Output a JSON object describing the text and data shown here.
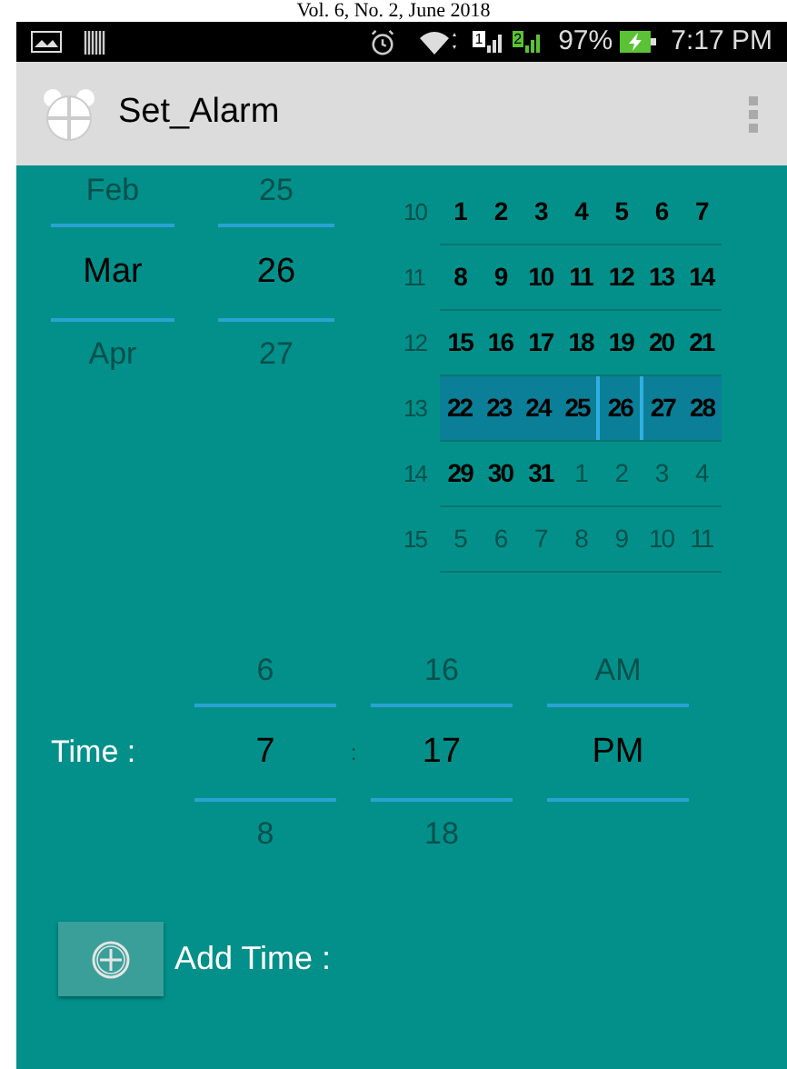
{
  "page_header": "Vol. 6, No. 2, June 2018",
  "status_bar": {
    "sim_1": "1",
    "sim_2": "2",
    "battery": "97%",
    "time": "7:17 PM"
  },
  "app_bar": {
    "title": "Set_Alarm"
  },
  "date_picker": {
    "months": [
      {
        "label": "Feb",
        "selected": false
      },
      {
        "label": "Mar",
        "selected": true
      },
      {
        "label": "Apr",
        "selected": false
      }
    ],
    "days": [
      {
        "label": "25",
        "selected": false
      },
      {
        "label": "26",
        "selected": true
      },
      {
        "label": "27",
        "selected": false
      }
    ]
  },
  "calendar": {
    "weeks": [
      {
        "number": "10",
        "selected": false,
        "days": [
          {
            "label": "1",
            "in_month": true,
            "selected": false
          },
          {
            "label": "2",
            "in_month": true,
            "selected": false
          },
          {
            "label": "3",
            "in_month": true,
            "selected": false
          },
          {
            "label": "4",
            "in_month": true,
            "selected": false
          },
          {
            "label": "5",
            "in_month": true,
            "selected": false
          },
          {
            "label": "6",
            "in_month": true,
            "selected": false
          },
          {
            "label": "7",
            "in_month": true,
            "selected": false
          }
        ]
      },
      {
        "number": "11",
        "selected": false,
        "days": [
          {
            "label": "8",
            "in_month": true,
            "selected": false
          },
          {
            "label": "9",
            "in_month": true,
            "selected": false
          },
          {
            "label": "10",
            "in_month": true,
            "selected": false
          },
          {
            "label": "11",
            "in_month": true,
            "selected": false
          },
          {
            "label": "12",
            "in_month": true,
            "selected": false
          },
          {
            "label": "13",
            "in_month": true,
            "selected": false
          },
          {
            "label": "14",
            "in_month": true,
            "selected": false
          }
        ]
      },
      {
        "number": "12",
        "selected": false,
        "days": [
          {
            "label": "15",
            "in_month": true,
            "selected": false
          },
          {
            "label": "16",
            "in_month": true,
            "selected": false
          },
          {
            "label": "17",
            "in_month": true,
            "selected": false
          },
          {
            "label": "18",
            "in_month": true,
            "selected": false
          },
          {
            "label": "19",
            "in_month": true,
            "selected": false
          },
          {
            "label": "20",
            "in_month": true,
            "selected": false
          },
          {
            "label": "21",
            "in_month": true,
            "selected": false
          }
        ]
      },
      {
        "number": "13",
        "selected": true,
        "days": [
          {
            "label": "22",
            "in_month": true,
            "selected": false
          },
          {
            "label": "23",
            "in_month": true,
            "selected": false
          },
          {
            "label": "24",
            "in_month": true,
            "selected": false
          },
          {
            "label": "25",
            "in_month": true,
            "selected": false
          },
          {
            "label": "26",
            "in_month": true,
            "selected": true
          },
          {
            "label": "27",
            "in_month": true,
            "selected": false
          },
          {
            "label": "28",
            "in_month": true,
            "selected": false
          }
        ]
      },
      {
        "number": "14",
        "selected": false,
        "days": [
          {
            "label": "29",
            "in_month": true,
            "selected": false
          },
          {
            "label": "30",
            "in_month": true,
            "selected": false
          },
          {
            "label": "31",
            "in_month": true,
            "selected": false
          },
          {
            "label": "1",
            "in_month": false,
            "selected": false
          },
          {
            "label": "2",
            "in_month": false,
            "selected": false
          },
          {
            "label": "3",
            "in_month": false,
            "selected": false
          },
          {
            "label": "4",
            "in_month": false,
            "selected": false
          }
        ]
      },
      {
        "number": "15",
        "selected": false,
        "days": [
          {
            "label": "5",
            "in_month": false,
            "selected": false
          },
          {
            "label": "6",
            "in_month": false,
            "selected": false
          },
          {
            "label": "7",
            "in_month": false,
            "selected": false
          },
          {
            "label": "8",
            "in_month": false,
            "selected": false
          },
          {
            "label": "9",
            "in_month": false,
            "selected": false
          },
          {
            "label": "10",
            "in_month": false,
            "selected": false
          },
          {
            "label": "11",
            "in_month": false,
            "selected": false
          }
        ]
      }
    ]
  },
  "time_picker": {
    "label": "Time :",
    "separator": ":",
    "hour": [
      {
        "label": "6",
        "selected": false
      },
      {
        "label": "7",
        "selected": true
      },
      {
        "label": "8",
        "selected": false
      }
    ],
    "minute": [
      {
        "label": "16",
        "selected": false
      },
      {
        "label": "17",
        "selected": true
      },
      {
        "label": "18",
        "selected": false
      }
    ],
    "ampm": [
      {
        "label": "AM",
        "selected": false
      },
      {
        "label": "PM",
        "selected": true
      }
    ]
  },
  "add_time": {
    "label": "Add Time :"
  }
}
